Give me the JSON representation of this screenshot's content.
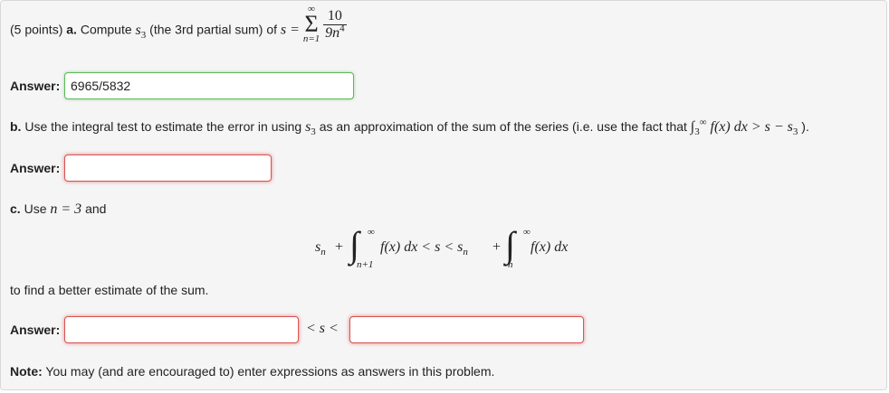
{
  "part_a": {
    "points": "(5 points)",
    "letter": "a.",
    "text_before": "Compute",
    "s3": "s",
    "s3_sub": "3",
    "text_paren": "(the 3rd partial sum) of",
    "s_eq": "s =",
    "sum_top": "∞",
    "sum_bottom": "n=1",
    "frac_num": "10",
    "frac_den": "9n",
    "frac_den_exp": "4",
    "answer_label": "Answer:",
    "answer_value": "6965/5832"
  },
  "part_b": {
    "letter": "b.",
    "text": "Use the integral test to estimate the error in using",
    "s3": "s",
    "s3_sub": "3",
    "text2": "as an approximation of the sum of the series (i.e. use the fact that",
    "int_lower": "3",
    "int_upper": "∞",
    "integrand": "f(x) dx > s − s",
    "integrand_sub": "3",
    "close": ").",
    "answer_label": "Answer:",
    "answer_value": ""
  },
  "part_c": {
    "letter": "c.",
    "text": "Use",
    "n_eq": "n = 3",
    "and": "and",
    "ineq": {
      "s_left": "s",
      "s_left_sub": "n",
      "plus1": "+",
      "int1_upper": "∞",
      "int1_lower": "n+1",
      "int1_body": "f(x) dx < s < s",
      "s_mid_sub": "n",
      "plus2": "+",
      "int2_upper": "∞",
      "int2_lower": "n",
      "int2_body": "f(x) dx"
    },
    "text_after": "to find a better estimate of the sum.",
    "answer_label": "Answer:",
    "lower_value": "",
    "middle": "< s <",
    "upper_value": ""
  },
  "note": {
    "label": "Note:",
    "text": "You may (and are encouraged to) enter expressions as answers in this problem."
  },
  "colors": {
    "correct": "#5cb85c",
    "incorrect": "#d9534f"
  }
}
